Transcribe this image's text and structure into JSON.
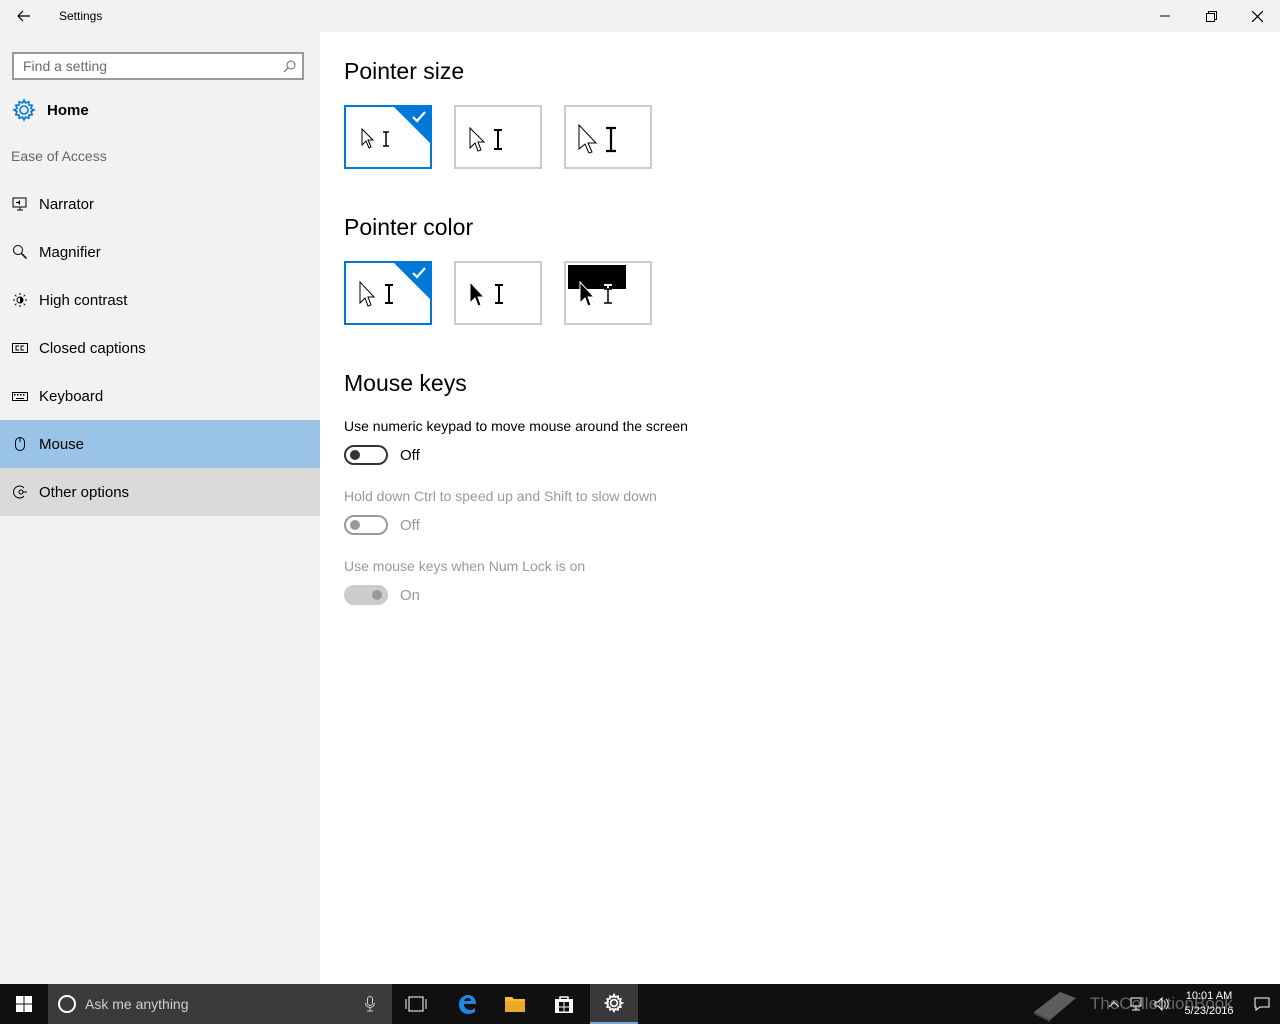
{
  "window": {
    "title": "Settings"
  },
  "sidebar": {
    "search_placeholder": "Find a setting",
    "home_label": "Home",
    "section_label": "Ease of Access",
    "items": [
      {
        "label": "Narrator",
        "icon": "narrator-icon"
      },
      {
        "label": "Magnifier",
        "icon": "magnifier-icon"
      },
      {
        "label": "High contrast",
        "icon": "high-contrast-icon"
      },
      {
        "label": "Closed captions",
        "icon": "closed-captions-icon"
      },
      {
        "label": "Keyboard",
        "icon": "keyboard-icon"
      },
      {
        "label": "Mouse",
        "icon": "mouse-icon",
        "state": "selected"
      },
      {
        "label": "Other options",
        "icon": "other-options-icon",
        "state": "hover"
      }
    ]
  },
  "main": {
    "pointer_size": {
      "heading": "Pointer size",
      "options": [
        {
          "name": "small",
          "selected": true
        },
        {
          "name": "medium",
          "selected": false
        },
        {
          "name": "large",
          "selected": false
        }
      ]
    },
    "pointer_color": {
      "heading": "Pointer color",
      "options": [
        {
          "name": "white",
          "selected": true
        },
        {
          "name": "black",
          "selected": false
        },
        {
          "name": "inverted",
          "selected": false
        }
      ]
    },
    "mouse_keys": {
      "heading": "Mouse keys",
      "toggles": [
        {
          "label": "Use numeric keypad to move mouse around the screen",
          "state": "Off",
          "enabled": true
        },
        {
          "label": "Hold down Ctrl to speed up and Shift to slow down",
          "state": "Off",
          "enabled": false
        },
        {
          "label": "Use mouse keys when Num Lock is on",
          "state": "On",
          "enabled": false
        }
      ]
    }
  },
  "taskbar": {
    "search_placeholder": "Ask me anything",
    "clock_time": "10:01 AM",
    "clock_date": "5/23/2016",
    "watermark": "TheCollectionBook"
  },
  "colors": {
    "accent": "#0078d7",
    "selected_nav": "#99c4e8",
    "sidebar_bg": "#f2f2f2"
  }
}
